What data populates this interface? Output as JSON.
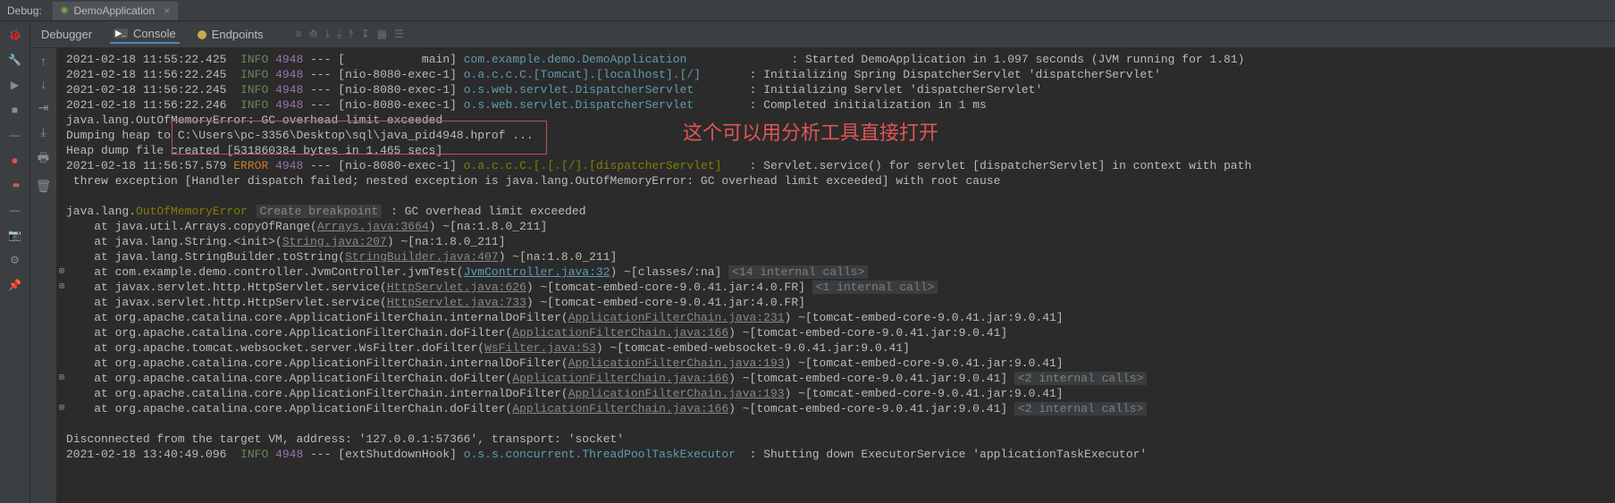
{
  "topbar": {
    "debug_label": "Debug:",
    "tab_name": "DemoApplication",
    "close_glyph": "×"
  },
  "subtabs": {
    "debugger": "Debugger",
    "console": "Console",
    "endpoints": "Endpoints"
  },
  "console": {
    "rows": [
      {
        "ts": "2021-02-18 11:55:22.425",
        "level": "INFO",
        "pid": "4948",
        "dash": " --- [",
        "thread": "           main",
        "brk": "] ",
        "logger": "com.example.demo.DemoApplication",
        "pad": "               ",
        "colon": ": ",
        "msg": "Started DemoApplication in 1.097 seconds (JVM running for 1.81)"
      },
      {
        "ts": "2021-02-18 11:56:22.245",
        "level": "INFO",
        "pid": "4948",
        "dash": " --- [",
        "thread": "nio-8080-exec-1",
        "brk": "] ",
        "logger": "o.a.c.c.C.[Tomcat].[localhost].[/]",
        "pad": "       ",
        "colon": ": ",
        "msg": "Initializing Spring DispatcherServlet 'dispatcherServlet'"
      },
      {
        "ts": "2021-02-18 11:56:22.245",
        "level": "INFO",
        "pid": "4948",
        "dash": " --- [",
        "thread": "nio-8080-exec-1",
        "brk": "] ",
        "logger": "o.s.web.servlet.DispatcherServlet",
        "pad": "        ",
        "colon": ": ",
        "msg": "Initializing Servlet 'dispatcherServlet'"
      },
      {
        "ts": "2021-02-18 11:56:22.246",
        "level": "INFO",
        "pid": "4948",
        "dash": " --- [",
        "thread": "nio-8080-exec-1",
        "brk": "] ",
        "logger": "o.s.web.servlet.DispatcherServlet",
        "pad": "        ",
        "colon": ": ",
        "msg": "Completed initialization in 1 ms"
      }
    ],
    "oom_line": "java.lang.OutOfMemoryError: GC overhead limit exceeded",
    "dump_prefix": "Dumping heap to ",
    "dump_path": "C:\\Users\\pc-3356\\Desktop\\sql\\java_pid4948.hprof ...",
    "heap_prefix": "Heap dump file ",
    "heap_rest": "created [531860384 bytes in 1.465 secs]",
    "err_row": {
      "ts": "2021-02-18 11:56:57.579",
      "level": "ERROR",
      "pid": "4948",
      "dash": " --- [",
      "thread": "nio-8080-exec-1",
      "brk": "] ",
      "logger": "o.a.c.c.C.[.[.[/].[dispatcherServlet]",
      "pad": "    ",
      "colon": ": ",
      "msg": "Servlet.service() for servlet [dispatcherServlet] in context with path "
    },
    "err_cont": " threw exception [Handler dispatch failed; nested exception is java.lang.OutOfMemoryError: GC overhead limit exceeded] with root cause",
    "blank": " ",
    "stack_head_a": "java.lang.",
    "stack_head_b": "OutOfMemoryError",
    "create_bp": "Create breakpoint",
    "stack_head_c": ": GC overhead limit exceeded",
    "stack": [
      {
        "pre": "    at java.util.Arrays.copyOfRange(",
        "lnk": "Arrays.java:3664",
        "post": ") ~[na:1.8.0_211]"
      },
      {
        "pre": "    at java.lang.String.<init>(",
        "lnk": "String.java:207",
        "post": ") ~[na:1.8.0_211]"
      },
      {
        "pre": "    at java.lang.StringBuilder.toString(",
        "lnk": "StringBuilder.java:407",
        "post": ") ~[na:1.8.0_211]"
      },
      {
        "pre": "    at com.example.demo.controller.JvmController.jvmTest(",
        "lnk": "JvmController.java:32",
        "post": ") ~[classes/:na]",
        "badge": "<14 internal calls>",
        "blue": true
      },
      {
        "pre": "    at javax.servlet.http.HttpServlet.service(",
        "lnk": "HttpServlet.java:626",
        "post": ") ~[tomcat-embed-core-9.0.41.jar:4.0.FR]",
        "badge": "<1 internal call>"
      },
      {
        "pre": "    at javax.servlet.http.HttpServlet.service(",
        "lnk": "HttpServlet.java:733",
        "post": ") ~[tomcat-embed-core-9.0.41.jar:4.0.FR]"
      },
      {
        "pre": "    at org.apache.catalina.core.ApplicationFilterChain.internalDoFilter(",
        "lnk": "ApplicationFilterChain.java:231",
        "post": ") ~[tomcat-embed-core-9.0.41.jar:9.0.41]"
      },
      {
        "pre": "    at org.apache.catalina.core.ApplicationFilterChain.doFilter(",
        "lnk": "ApplicationFilterChain.java:166",
        "post": ") ~[tomcat-embed-core-9.0.41.jar:9.0.41]"
      },
      {
        "pre": "    at org.apache.tomcat.websocket.server.WsFilter.doFilter(",
        "lnk": "WsFilter.java:53",
        "post": ") ~[tomcat-embed-websocket-9.0.41.jar:9.0.41]"
      },
      {
        "pre": "    at org.apache.catalina.core.ApplicationFilterChain.internalDoFilter(",
        "lnk": "ApplicationFilterChain.java:193",
        "post": ") ~[tomcat-embed-core-9.0.41.jar:9.0.41]"
      },
      {
        "pre": "    at org.apache.catalina.core.ApplicationFilterChain.doFilter(",
        "lnk": "ApplicationFilterChain.java:166",
        "post": ") ~[tomcat-embed-core-9.0.41.jar:9.0.41]",
        "badge": "<2 internal calls>"
      },
      {
        "pre": "    at org.apache.catalina.core.ApplicationFilterChain.internalDoFilter(",
        "lnk": "ApplicationFilterChain.java:193",
        "post": ") ~[tomcat-embed-core-9.0.41.jar:9.0.41]"
      },
      {
        "pre": "    at org.apache.catalina.core.ApplicationFilterChain.doFilter(",
        "lnk": "ApplicationFilterChain.java:166",
        "post": ") ~[tomcat-embed-core-9.0.41.jar:9.0.41]",
        "badge": "<2 internal calls>"
      }
    ],
    "disconnect": "Disconnected from the target VM, address: '127.0.0.1:57366', transport: 'socket'",
    "last_row": {
      "ts": "2021-02-18 13:40:49.096",
      "level": "INFO",
      "pid": "4948",
      "dash": " --- [",
      "thread": "extShutdownHook",
      "brk": "] ",
      "logger": "o.s.s.concurrent.ThreadPoolTaskExecutor",
      "pad": "  ",
      "colon": ": ",
      "msg": "Shutting down ExecutorService 'applicationTaskExecutor'"
    }
  },
  "annotation": "这个可以用分析工具直接打开"
}
